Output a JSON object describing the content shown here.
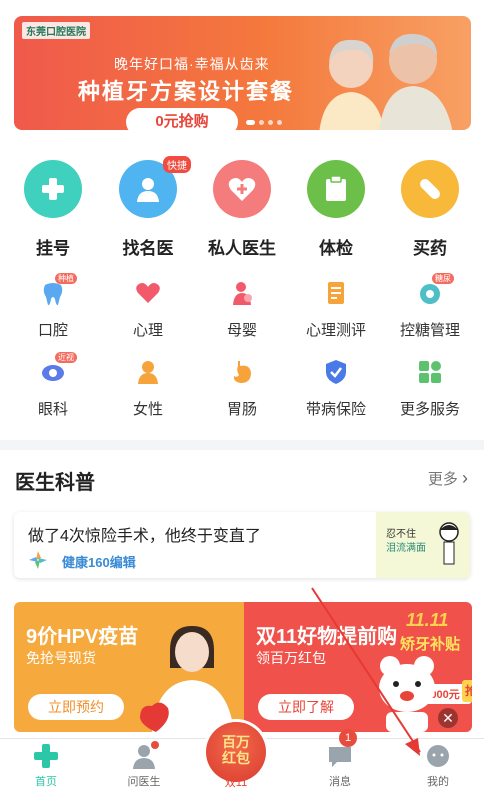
{
  "banner": {
    "logo": "东莞口腔医院",
    "subtitle": "晚年好口福·幸福从齿来",
    "title": "种植牙方案设计套餐",
    "button": "0元抢购"
  },
  "main_services": [
    {
      "label": "挂号",
      "color": "#3fd1bd",
      "icon": "plus-icon"
    },
    {
      "label": "找名医",
      "color": "#4fb4ef",
      "icon": "doctor-icon",
      "badge": "快捷"
    },
    {
      "label": "私人医生",
      "color": "#f47c7c",
      "icon": "heart-plus-icon"
    },
    {
      "label": "体检",
      "color": "#6cc04a",
      "icon": "clipboard-icon"
    },
    {
      "label": "买药",
      "color": "#f8b83a",
      "icon": "pill-icon"
    }
  ],
  "sub_services": [
    {
      "label": "口腔",
      "tag": "种植",
      "icon": "tooth-icon",
      "color": "#5aa9f0"
    },
    {
      "label": "心理",
      "icon": "heart-icon",
      "color": "#f2596a"
    },
    {
      "label": "母婴",
      "icon": "mother-baby-icon",
      "color": "#f2596a"
    },
    {
      "label": "心理测评",
      "icon": "test-paper-icon",
      "color": "#f6a33b"
    },
    {
      "label": "控糖管理",
      "tag": "糖尿",
      "icon": "glucose-icon",
      "color": "#4fbfc7"
    },
    {
      "label": "眼科",
      "tag": "近视",
      "icon": "eye-icon",
      "color": "#5a7be8"
    },
    {
      "label": "女性",
      "icon": "female-icon",
      "color": "#f6a33b"
    },
    {
      "label": "胃肠",
      "icon": "stomach-icon",
      "color": "#f6a33b"
    },
    {
      "label": "带病保险",
      "icon": "shield-icon",
      "color": "#4a7ae8"
    },
    {
      "label": "更多服务",
      "icon": "grid-icon",
      "color": "#5cc26d"
    }
  ],
  "section": {
    "title": "医生科普",
    "more": "更多"
  },
  "article": {
    "title": "做了4次惊险手术，他终于变直了",
    "source": "健康160编辑",
    "thumb_text_1": "忍不住",
    "thumb_text_2": "泪流满面"
  },
  "promos": [
    {
      "title": "9价HPV疫苗",
      "subtitle": "免抢号现货",
      "button": "立即预约",
      "color": "#f6a93c"
    },
    {
      "title": "双11好物提前购",
      "subtitle": "领百万红包",
      "button": "立即了解",
      "color": "#f0514a",
      "sticker_top": "11.11",
      "sticker_mid": "矫牙补贴",
      "sticker_amount": "10000元",
      "sticker_side": "抢"
    }
  ],
  "tabbar": {
    "home": "首页",
    "ask": "问医生",
    "center_top": "百万",
    "center_bottom": "红包",
    "center_label": "双11",
    "messages": "消息",
    "messages_badge": "1",
    "mine": "我的"
  }
}
